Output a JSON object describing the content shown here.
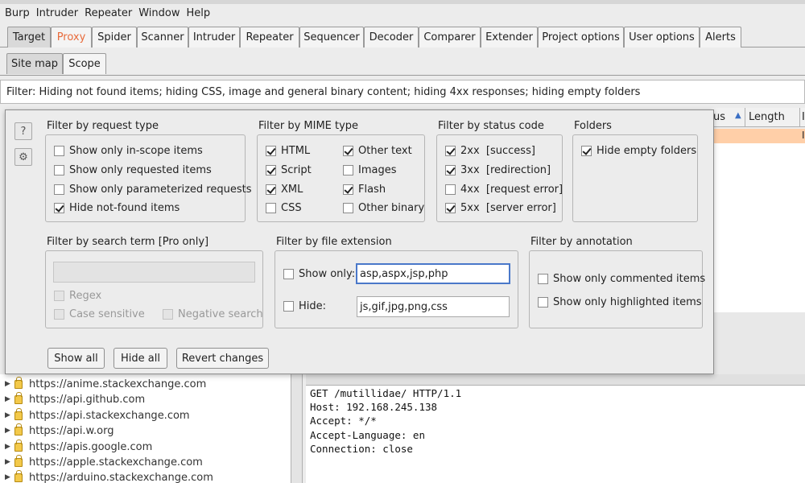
{
  "menu": [
    "Burp",
    "Intruder",
    "Repeater",
    "Window",
    "Help"
  ],
  "main_tabs": [
    "Target",
    "Proxy",
    "Spider",
    "Scanner",
    "Intruder",
    "Repeater",
    "Sequencer",
    "Decoder",
    "Comparer",
    "Extender",
    "Project options",
    "User options",
    "Alerts"
  ],
  "sub_tabs": [
    "Site map",
    "Scope"
  ],
  "filter_bar_text": "Filter: Hiding not found items;  hiding CSS, image and general binary content;  hiding 4xx responses;  hiding empty folders",
  "table_headers": {
    "status_fragment": "us",
    "length": "Length",
    "next_fragment": "I"
  },
  "table_cell_fragment": "I",
  "popup": {
    "help_icon_label": "?",
    "request_type": {
      "title": "Filter by request type",
      "items": [
        {
          "label": "Show only in-scope items",
          "checked": false
        },
        {
          "label": "Show only requested items",
          "checked": false
        },
        {
          "label": "Show only parameterized requests",
          "checked": false
        },
        {
          "label": "Hide not-found items",
          "checked": true
        }
      ]
    },
    "mime_type": {
      "title": "Filter by MIME type",
      "items": [
        {
          "label": "HTML",
          "checked": true
        },
        {
          "label": "Other text",
          "checked": true
        },
        {
          "label": "Script",
          "checked": true
        },
        {
          "label": "Images",
          "checked": false
        },
        {
          "label": "XML",
          "checked": true
        },
        {
          "label": "Flash",
          "checked": true
        },
        {
          "label": "CSS",
          "checked": false
        },
        {
          "label": "Other binary",
          "checked": false
        }
      ]
    },
    "status_code": {
      "title": "Filter by status code",
      "items": [
        {
          "label": "2xx  [success]",
          "checked": true
        },
        {
          "label": "3xx  [redirection]",
          "checked": true
        },
        {
          "label": "4xx  [request error]",
          "checked": false
        },
        {
          "label": "5xx  [server error]",
          "checked": true
        }
      ]
    },
    "folders": {
      "title": "Folders",
      "items": [
        {
          "label": "Hide empty folders",
          "checked": true
        }
      ]
    },
    "search_term": {
      "title": "Filter by search term [Pro only]",
      "value": "",
      "regex": "Regex",
      "case_sensitive": "Case sensitive",
      "negative_search": "Negative search"
    },
    "file_extension": {
      "title": "Filter by file extension",
      "show_only_label": "Show only:",
      "show_only_value": "asp,aspx,jsp,php",
      "hide_label": "Hide:",
      "hide_value": "js,gif,jpg,png,css"
    },
    "annotation": {
      "title": "Filter by annotation",
      "items": [
        {
          "label": "Show only commented items",
          "checked": false
        },
        {
          "label": "Show only highlighted items",
          "checked": false
        }
      ]
    },
    "buttons": {
      "show_all": "Show all",
      "hide_all": "Hide all",
      "revert": "Revert changes"
    }
  },
  "site_tree": [
    "https://anime.stackexchange.com",
    "https://api.github.com",
    "https://api.stackexchange.com",
    "https://api.w.org",
    "https://apis.google.com",
    "https://apple.stackexchange.com",
    "https://arduino.stackexchange.com"
  ],
  "request_lines": [
    "GET /mutillidae/ HTTP/1.1",
    "Host: 192.168.245.138",
    "Accept: */*",
    "Accept-Language: en",
    "Connection: close"
  ],
  "colors": {
    "accent_orange": "#e86a3a",
    "highlight_row": "#ffcfa8",
    "focus_blue": "#4a78c9"
  }
}
